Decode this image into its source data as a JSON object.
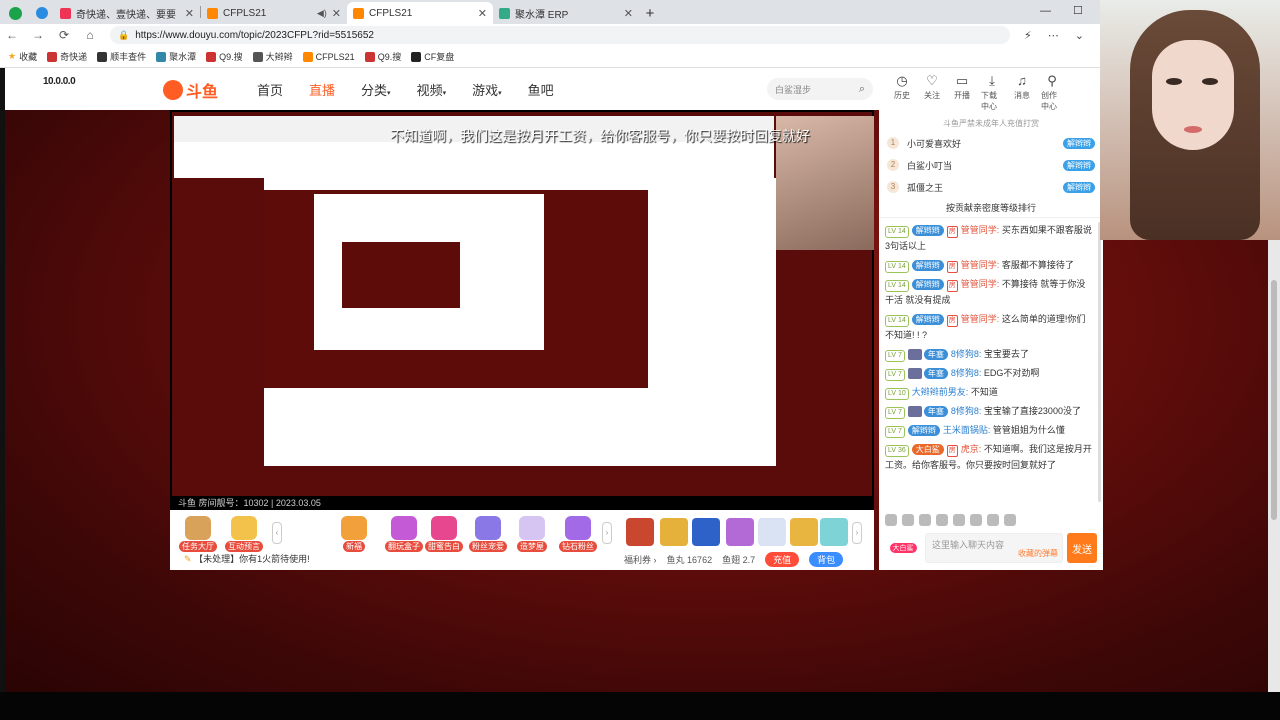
{
  "browser": {
    "tabs": [
      {
        "title": "奇快递、壹快递、要要",
        "active": false
      },
      {
        "title": "CFPLS21",
        "active": false
      },
      {
        "title": "CFPLS21",
        "active": true
      },
      {
        "title": "聚水潭 ERP",
        "active": false
      }
    ],
    "url": "https://www.douyu.com/topic/2023CFPL?rid=5515652",
    "bookmarks": [
      "收藏",
      "奇快递",
      "顺丰查件",
      "聚水潭",
      "Q9.搜",
      "大辫辫",
      "CFPLS21",
      "Q9.搜",
      "CF复盘"
    ]
  },
  "site": {
    "mini_logo": "10.0.0.0",
    "logo": "斗鱼",
    "nav": [
      "首页",
      "直播",
      "分类",
      "视频",
      "游戏",
      "鱼吧"
    ],
    "nav_active": "直播",
    "search_placeholder": "白鲨湿步",
    "tools": [
      {
        "icon": "history-icon",
        "label": "历史"
      },
      {
        "icon": "heart-icon",
        "label": "关注"
      },
      {
        "icon": "broadcast-icon",
        "label": "开播"
      },
      {
        "icon": "download-icon",
        "label": "下载中心"
      },
      {
        "icon": "bell-icon",
        "label": "消息"
      },
      {
        "icon": "creator-icon",
        "label": "创作中心"
      }
    ]
  },
  "video": {
    "danmaku": "不知道啊，我们这是按月开工资，给你客服号，你只要按时回复就好",
    "room_info": "斗鱼 房间靓号：10302 | 2023.03.05"
  },
  "gift_bar": {
    "left_items": [
      "任务大厅",
      "互动预言"
    ],
    "gifts": [
      "新福",
      "翻玩盒子",
      "甜蜜告白",
      "粉丝宠爱",
      "造梦屋",
      "钻石粉丝"
    ],
    "notice": "【未处理】你有1火箭待使用!",
    "stats": {
      "welfare": "福利券",
      "fishball_label": "鱼丸",
      "fishball": "16762",
      "fishwing_label": "鱼翅",
      "fishwing": "2.7"
    },
    "recharge": "充值",
    "backpack": "背包"
  },
  "chat": {
    "rank_title": "斗鱼严禁未成年人充值打赏",
    "rank": [
      {
        "n": "1",
        "name": "小可爱喜欢好",
        "badge": "解辫辫"
      },
      {
        "n": "2",
        "name": "白鲨小叮当",
        "badge": "解辫辫"
      },
      {
        "n": "3",
        "name": "孤僵之王",
        "badge": "解辫辫"
      }
    ],
    "rank_more": "按贡献亲密度等级排行",
    "messages": [
      {
        "lv": "LV 14",
        "fan": "解辫辫",
        "tag": "房",
        "user": "管管同学:",
        "text": "买东西如果不跟客服说3句话以上"
      },
      {
        "lv": "LV 14",
        "fan": "解辫辫",
        "tag": "房",
        "user": "管管同学:",
        "text": "客服都不算接待了"
      },
      {
        "lv": "LV 14",
        "fan": "解辫辫",
        "tag": "房",
        "user": "管管同学:",
        "text": "不算接待 就等于你没干活 就没有提成"
      },
      {
        "lv": "LV 14",
        "fan": "解辫辫",
        "tag": "房",
        "user": "管管同学:",
        "text": "这么简单的道理!你们不知道! ! ?"
      },
      {
        "lv": "LV 7",
        "fan": "年塞",
        "tag": "",
        "user": "8修狗8:",
        "text": "宝宝要去了"
      },
      {
        "lv": "LV 7",
        "fan": "年塞",
        "tag": "",
        "user": "8修狗8:",
        "text": "EDG不对劲啊"
      },
      {
        "lv": "LV 10",
        "fan": "",
        "tag": "",
        "user": "大辫辫前男友:",
        "text": "不知道"
      },
      {
        "lv": "LV 7",
        "fan": "年塞",
        "tag": "",
        "user": "8修狗8:",
        "text": "宝宝输了直接23000没了"
      },
      {
        "lv": "LV 7",
        "fan": "解辫辫",
        "tag": "",
        "user": "王米面锅贴:",
        "text": "管管姐姐为什么懂"
      },
      {
        "lv": "LV 36",
        "fan": "大白鲨",
        "tag": "房",
        "user": "虎京:",
        "text": "不知道啊。我们这是按月开工资。给你客服号。你只要按时回复就好了"
      }
    ],
    "fan_label": "大白鲨",
    "input_placeholder": "这里输入聊天内容",
    "input_sub": "收藏的弹幕",
    "send": "发送"
  }
}
